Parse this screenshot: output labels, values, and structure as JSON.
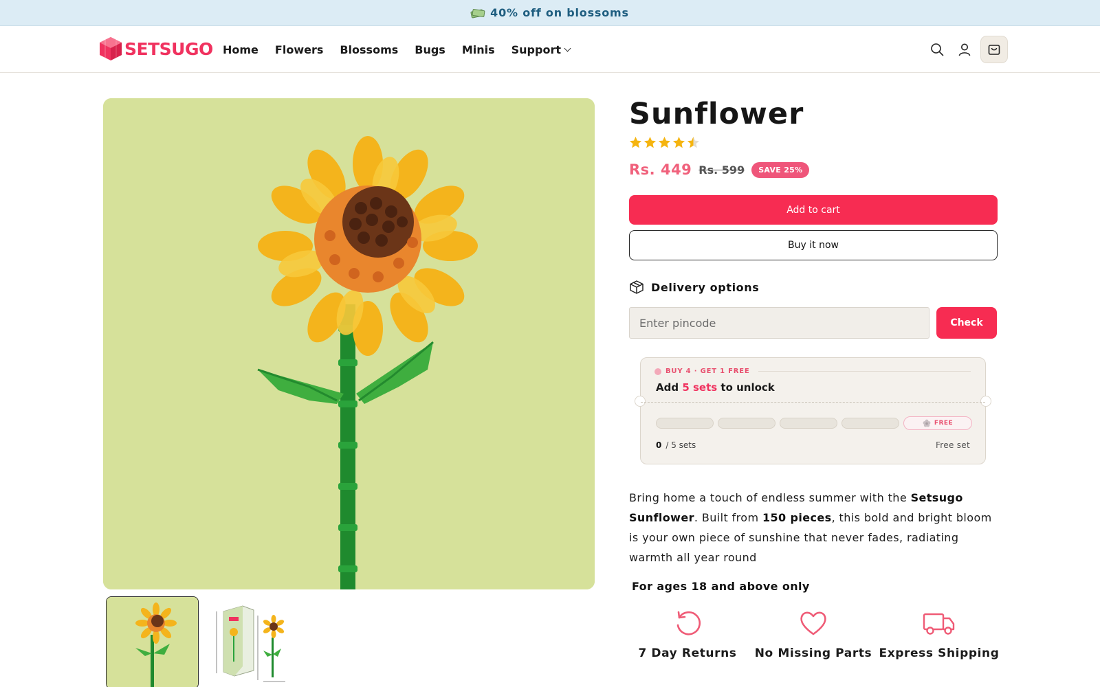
{
  "announcement": {
    "text": "40% off on blossoms",
    "icon": "money-icon"
  },
  "brand": {
    "name": "SETSUGO",
    "color": "#f0325f"
  },
  "nav": {
    "items": [
      {
        "label": "Home"
      },
      {
        "label": "Flowers"
      },
      {
        "label": "Blossoms"
      },
      {
        "label": "Bugs"
      },
      {
        "label": "Minis"
      },
      {
        "label": "Support",
        "has_dropdown": true
      }
    ]
  },
  "header_icons": [
    "search-icon",
    "account-icon",
    "cart-icon"
  ],
  "product": {
    "title": "Sunflower",
    "rating": 4.5,
    "price": "Rs. 449",
    "compare_price": "Rs. 599",
    "save_badge": "SAVE 25%",
    "add_to_cart": "Add to cart",
    "buy_now": "Buy it now",
    "thumbnails": [
      "sunflower-thumb",
      "box-dimensions-thumb"
    ]
  },
  "delivery": {
    "title": "Delivery options",
    "pincode_placeholder": "Enter pincode",
    "check_label": "Check"
  },
  "offer": {
    "tag": "BUY 4 · GET 1 FREE",
    "main_prefix": "Add ",
    "main_highlight": "5 sets",
    "main_suffix": " to unlock",
    "free_label": "FREE",
    "count": "0",
    "count_suffix": "/ 5 sets",
    "free_set_label": "Free set"
  },
  "description": {
    "p1": "Bring home a touch of endless summer with the ",
    "b1": "Setsugo Sunflower",
    "p2": ". Built from ",
    "b2": "150 pieces",
    "p3": ", this bold and bright bloom is your own piece of sunshine that never fades, radiating warmth all year round"
  },
  "age_notice": "For ages 18 and above only",
  "features": [
    {
      "label": "7 Day Returns",
      "icon": "returns-icon"
    },
    {
      "label": "No Missing Parts",
      "icon": "heart-icon"
    },
    {
      "label": "Express Shipping",
      "icon": "truck-icon"
    }
  ],
  "colors": {
    "accent": "#f72c52",
    "price": "#f0617c",
    "announce_bg": "#dcecf5",
    "image_bg": "#d6e19a"
  }
}
